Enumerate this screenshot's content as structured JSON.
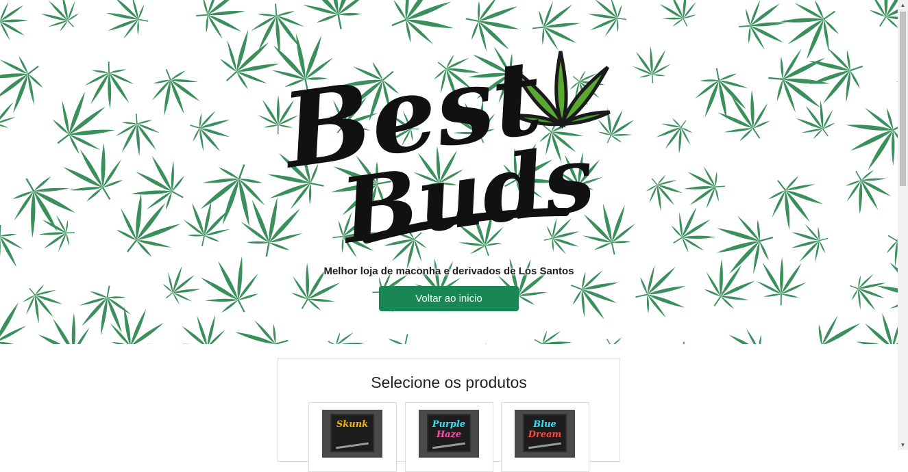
{
  "hero": {
    "logo_line1": "Best",
    "logo_line2": "Buds",
    "tagline": "Melhor loja de maconha e derivados de Los Santos",
    "back_button_label": "Voltar ao inicio"
  },
  "products": {
    "title": "Selecione os produtos",
    "items": [
      {
        "label": "Skunk",
        "color": "#f5b400"
      },
      {
        "label_line1": "Purple",
        "label_line2": "Haze",
        "color": "#ff4fb0"
      },
      {
        "label_line1": "Blue",
        "label_line2": "Dream",
        "color": "#ff4a3a"
      }
    ]
  },
  "colors": {
    "leaf": "#3a8f5c",
    "button": "#198754"
  }
}
